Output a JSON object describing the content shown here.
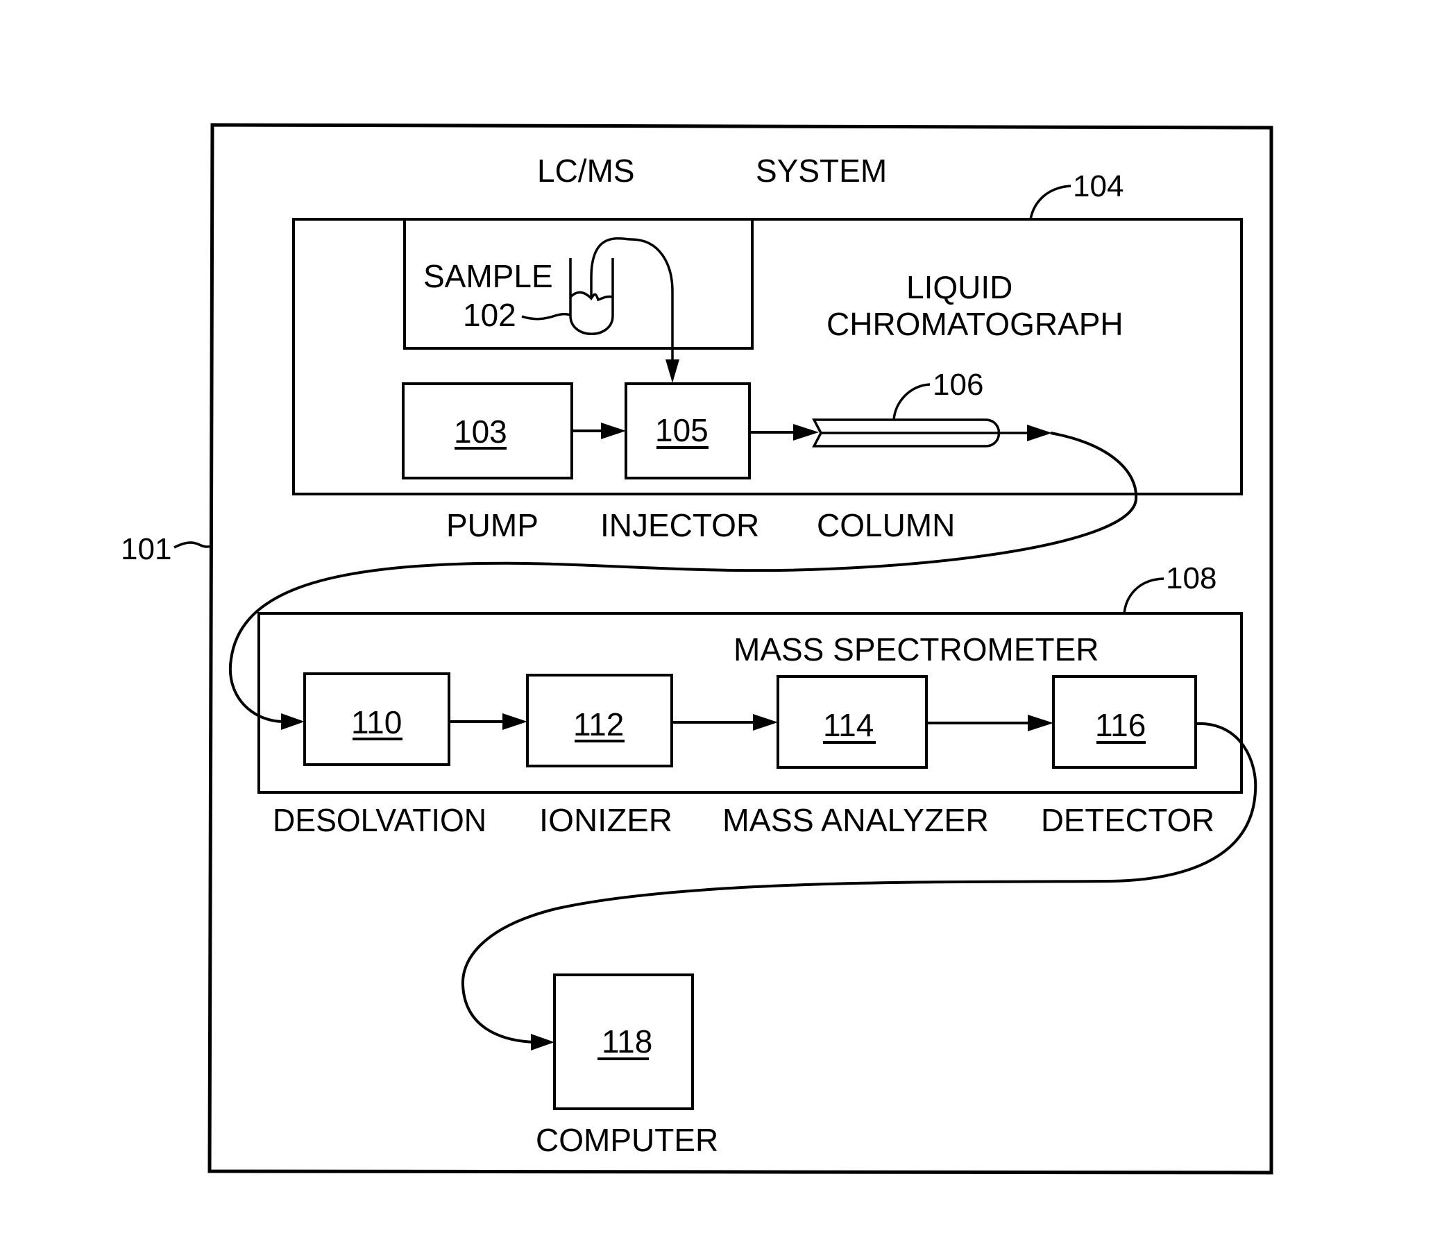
{
  "figure": {
    "title_left": "LC/MS",
    "title_right": "SYSTEM",
    "system_ref": "101"
  },
  "liquid_chromatograph": {
    "ref": "104",
    "label_line1": "LIQUID",
    "label_line2": "CHROMATOGRAPH",
    "sample": {
      "label": "SAMPLE",
      "ref": "102"
    },
    "pump": {
      "ref": "103",
      "label": "PUMP"
    },
    "injector": {
      "ref": "105",
      "label": "INJECTOR"
    },
    "column": {
      "ref": "106",
      "label": "COLUMN"
    }
  },
  "mass_spectrometer": {
    "ref": "108",
    "label": "MASS SPECTROMETER",
    "stages": [
      {
        "ref": "110",
        "label": "DESOLVATION"
      },
      {
        "ref": "112",
        "label": "IONIZER"
      },
      {
        "ref": "114",
        "label": "MASS ANALYZER"
      },
      {
        "ref": "116",
        "label": "DETECTOR"
      }
    ]
  },
  "computer": {
    "ref": "118",
    "label": "COMPUTER"
  }
}
